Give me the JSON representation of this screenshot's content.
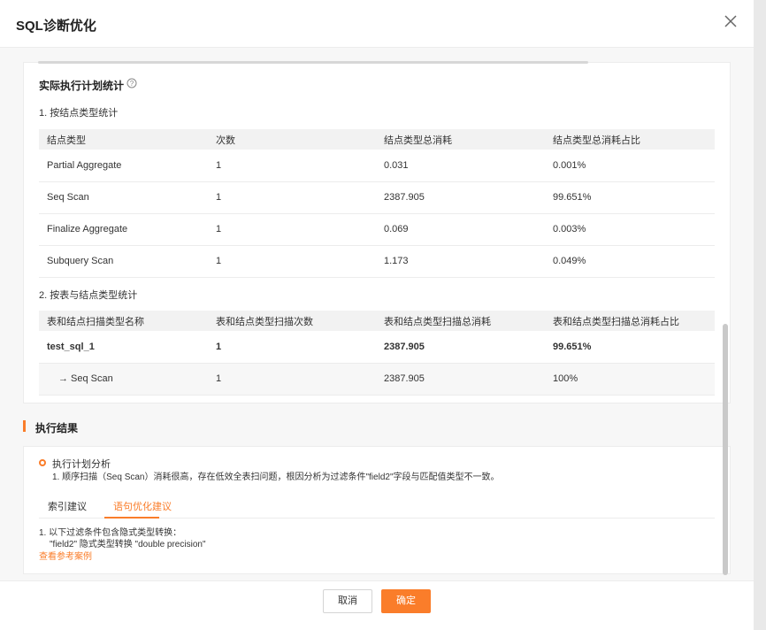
{
  "dialog": {
    "title": "SQL诊断优化"
  },
  "stats": {
    "section_title": "实际执行计划统计",
    "by_node_type": {
      "label": "1. 按结点类型统计",
      "headers": [
        "结点类型",
        "次数",
        "结点类型总消耗",
        "结点类型总消耗占比"
      ],
      "rows": [
        [
          "Partial Aggregate",
          "1",
          "0.031",
          "0.001%"
        ],
        [
          "Seq Scan",
          "1",
          "2387.905",
          "99.651%"
        ],
        [
          "Finalize Aggregate",
          "1",
          "0.069",
          "0.003%"
        ],
        [
          "Subquery Scan",
          "1",
          "1.173",
          "0.049%"
        ]
      ]
    },
    "by_table_node_type": {
      "label": "2. 按表与结点类型统计",
      "headers": [
        "表和结点扫描类型名称",
        "表和结点类型扫描次数",
        "表和结点类型扫描总消耗",
        "表和结点类型扫描总消耗占比"
      ],
      "rows": [
        [
          "test_sql_1",
          "1",
          "2387.905",
          "99.651%"
        ],
        [
          "→ Seq Scan",
          "1",
          "2387.905",
          "100%"
        ]
      ]
    }
  },
  "result": {
    "title": "执行结果",
    "analysis_label": "执行计划分析",
    "analysis_text": "1. 顺序扫描（Seq Scan）消耗很高，存在低效全表扫问题，根因分析为过滤条件\"field2\"字段与匹配值类型不一致。",
    "tabs": [
      "索引建议",
      "语句优化建议"
    ],
    "active_tab": 1,
    "suggestion_line1": "1. 以下过滤条件包含隐式类型转换：",
    "suggestion_line2": "\"field2\" 隐式类型转换 \"double precision\"",
    "reference_link": "查看参考案例"
  },
  "footer": {
    "cancel": "取消",
    "confirm": "确定"
  },
  "colors": {
    "accent": "#fa7d2a"
  }
}
